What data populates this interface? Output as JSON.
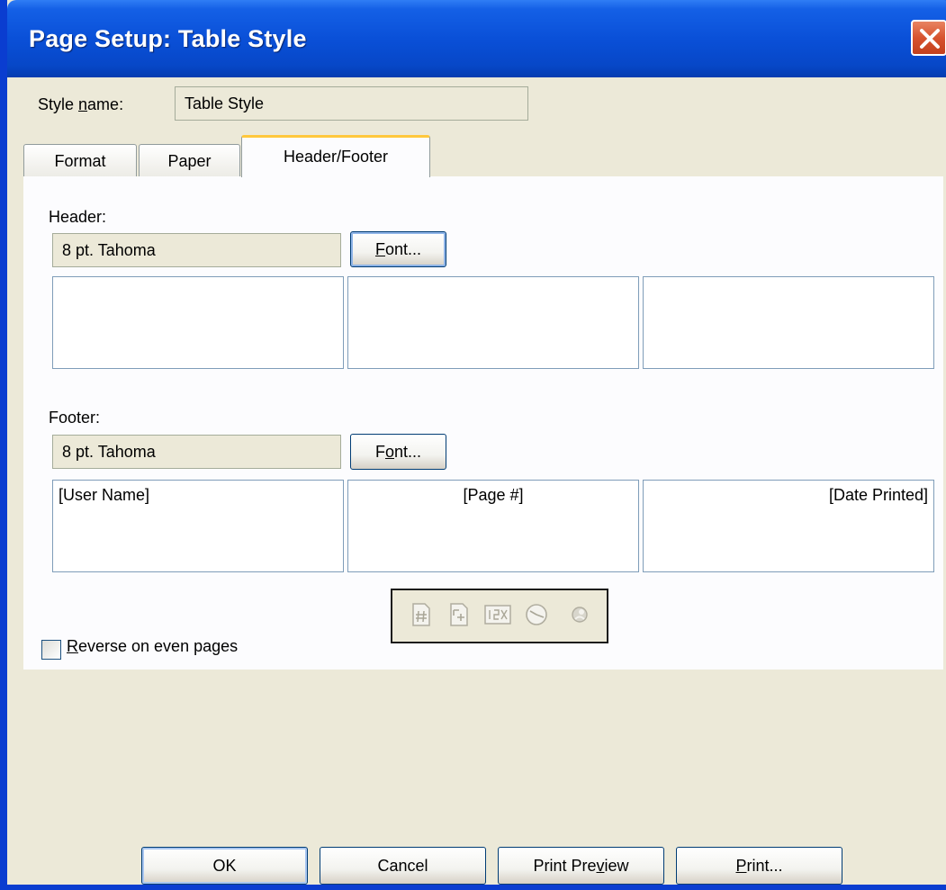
{
  "window": {
    "title": "Page Setup: Table Style"
  },
  "style_name": {
    "label_pre": "Style ",
    "label_accel": "n",
    "label_post": "ame:",
    "value": "Table Style"
  },
  "tabs": [
    {
      "label": "Format",
      "active": false
    },
    {
      "label": "Paper",
      "active": false
    },
    {
      "label": "Header/Footer",
      "active": true
    }
  ],
  "header": {
    "label": "Header:",
    "font_value": "8 pt. Tahoma",
    "font_button": {
      "accel": "F",
      "rest": "ont..."
    },
    "left": "",
    "center": "",
    "right": ""
  },
  "footer": {
    "label": "Footer:",
    "font_value": "8 pt. Tahoma",
    "font_button": {
      "pre": "F",
      "accel": "o",
      "rest": "nt..."
    },
    "left": "[User Name]",
    "center": "[Page #]",
    "right": "[Date Printed]"
  },
  "insert_toolbar": {
    "icons": [
      "page-number-icon",
      "page-count-icon",
      "page-of-pages-icon",
      "date-time-icon",
      "user-name-icon"
    ]
  },
  "reverse_checkbox": {
    "accel": "R",
    "rest": "everse on even pages",
    "checked": false
  },
  "buttons": {
    "ok": "OK",
    "cancel": "Cancel",
    "print_preview": {
      "pre": "Print Pre",
      "accel": "v",
      "rest": "iew"
    },
    "print": {
      "accel": "P",
      "rest": "rint..."
    }
  }
}
